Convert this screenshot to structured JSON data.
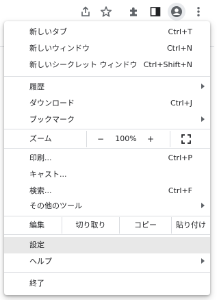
{
  "toolbar": {
    "icons": [
      "share-icon",
      "star-icon",
      "extensions-icon",
      "side-panel-icon",
      "profile-icon",
      "more-menu-icon"
    ]
  },
  "menu": {
    "new_tab": {
      "label": "新しいタブ",
      "shortcut": "Ctrl+T"
    },
    "new_window": {
      "label": "新しいウィンドウ",
      "shortcut": "Ctrl+N"
    },
    "new_incognito": {
      "label": "新しいシークレット ウィンドウ",
      "shortcut": "Ctrl+Shift+N"
    },
    "history": {
      "label": "履歴"
    },
    "downloads": {
      "label": "ダウンロード",
      "shortcut": "Ctrl+J"
    },
    "bookmarks": {
      "label": "ブックマーク"
    },
    "zoom": {
      "label": "ズーム",
      "minus": "−",
      "value": "100%",
      "plus": "+"
    },
    "print": {
      "label": "印刷...",
      "shortcut": "Ctrl+P"
    },
    "cast": {
      "label": "キャスト..."
    },
    "find": {
      "label": "検索...",
      "shortcut": "Ctrl+F"
    },
    "more_tools": {
      "label": "その他のツール"
    },
    "edit": {
      "label": "編集",
      "cut": "切り取り",
      "copy": "コピー",
      "paste": "貼り付け"
    },
    "settings": {
      "label": "設定"
    },
    "help": {
      "label": "ヘルプ"
    },
    "exit": {
      "label": "終了"
    }
  },
  "colors": {
    "highlight": "#e8e8e8",
    "separator": "#dadce0",
    "icon": "#5f6368",
    "text": "#202124"
  }
}
